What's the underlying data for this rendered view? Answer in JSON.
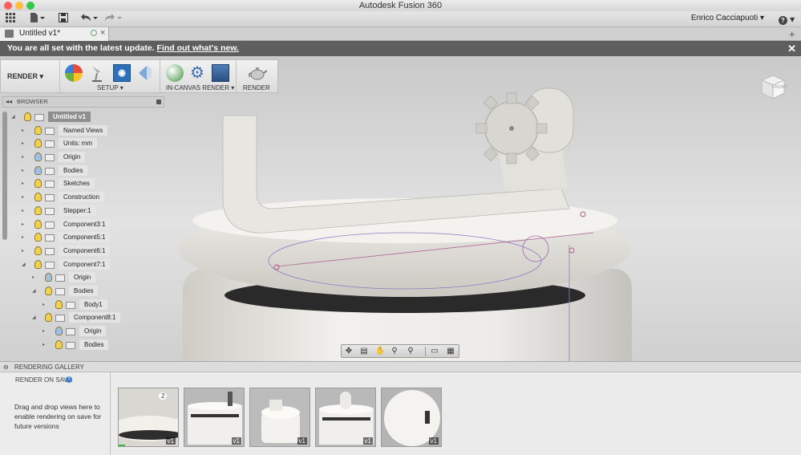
{
  "window": {
    "title": "Autodesk Fusion 360"
  },
  "toolbar": {
    "user_name": "Enrico Cacciapuoti",
    "help_label": "?"
  },
  "tab": {
    "label": "Untitled v1*"
  },
  "notice": {
    "text": "You are all set with the latest update.",
    "link": "Find out what's new."
  },
  "ribbon": {
    "workspace": "RENDER",
    "setup_label": "SETUP",
    "incanvas_label": "IN-CANVAS RENDER",
    "render_label": "RENDER"
  },
  "viewcube": {
    "face": "FRONT"
  },
  "browser": {
    "title": "BROWSER",
    "items": [
      {
        "label": "Untitled v1",
        "indent": 0
      },
      {
        "label": "Named Views",
        "indent": 1
      },
      {
        "label": "Units: mm",
        "indent": 1
      },
      {
        "label": "Origin",
        "indent": 1
      },
      {
        "label": "Bodies",
        "indent": 1
      },
      {
        "label": "Sketches",
        "indent": 1
      },
      {
        "label": "Construction",
        "indent": 1
      },
      {
        "label": "Stepper:1",
        "indent": 1
      },
      {
        "label": "Component3:1",
        "indent": 1
      },
      {
        "label": "Component5:1",
        "indent": 1
      },
      {
        "label": "Component6:1",
        "indent": 1
      },
      {
        "label": "Component7:1",
        "indent": 1
      },
      {
        "label": "Origin",
        "indent": 2
      },
      {
        "label": "Bodies",
        "indent": 2
      },
      {
        "label": "Body1",
        "indent": 3
      },
      {
        "label": "Component8:1",
        "indent": 2
      },
      {
        "label": "Origin",
        "indent": 3
      },
      {
        "label": "Bodies",
        "indent": 3
      }
    ]
  },
  "gallery": {
    "title": "RENDERING GALLERY",
    "render_on_save": "RENDER ON SAVE",
    "hint": "Drag and drop views here to enable rendering on save for future versions",
    "thumb_badge": "2",
    "thumbs": [
      "v1",
      "v1",
      "v1",
      "v1",
      "v1"
    ]
  }
}
